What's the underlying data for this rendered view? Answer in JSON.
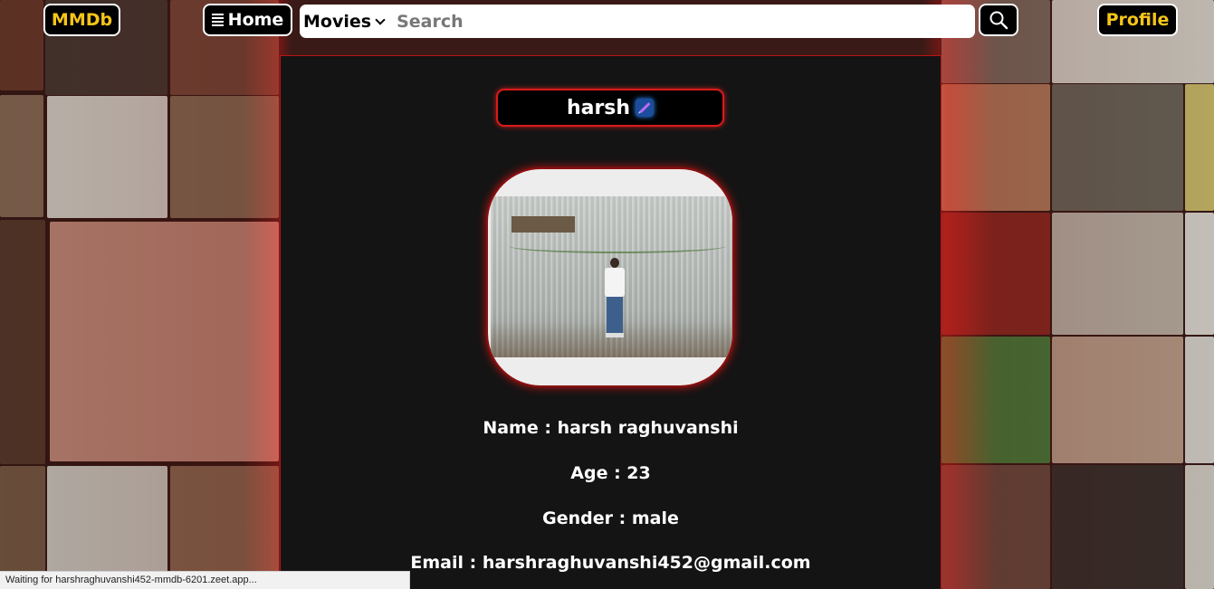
{
  "nav": {
    "brand": "MMDb",
    "home_label": "Home",
    "search_category": "Movies",
    "search_placeholder": "Search",
    "profile_label": "Profile"
  },
  "profile": {
    "username": "harsh",
    "name_line": "Name : harsh raghuvanshi",
    "age_line": "Age : 23",
    "gender_line": "Gender : male",
    "email_line": "Email : harshraghuvanshi452@gmail.com"
  },
  "status": {
    "text": "Waiting for harshraghuvanshi452-mmdb-6201.zeet.app..."
  },
  "colors": {
    "brand": "#f5c518",
    "accent_red": "#d81b1b",
    "card_bg": "#141414"
  },
  "icons": {
    "home": "menu-icon",
    "search": "search-icon",
    "edit": "pencil-icon",
    "dropdown": "chevron-down-icon"
  }
}
